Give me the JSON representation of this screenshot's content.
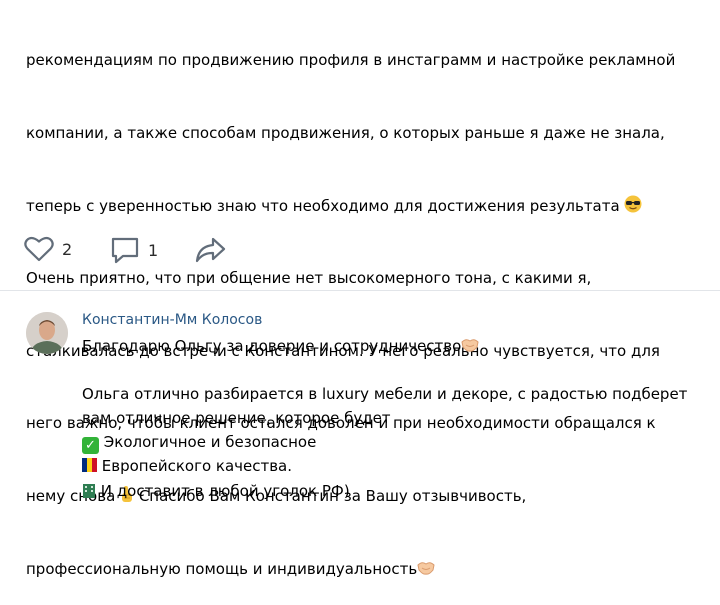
{
  "post": {
    "lines": [
      "рекомендациям по продвижению профиля в инстаграмм и настройке рекламной",
      "компании, а также способам продвижения, о которых раньше я даже не знала,",
      "теперь с уверенностью знаю что необходимо для достижения результата",
      "Очень приятно, что при общение нет высокомерного тона, с какими я,",
      "сталкивалась до встречи с Константином. У него реально чувствуется, что для",
      "него важно, чтобы клиент остался доволен и при необходимости обращался к",
      "нему снова",
      "Спасибо Вам Константин за Вашу отзывчивость,",
      "профессиональную помощь и индивидуальность"
    ]
  },
  "actions": {
    "likes": "2",
    "comments": "1"
  },
  "comment": {
    "author": "Константин-Мм Колосов",
    "lines": [
      "Благодарю Ольгу за доверие и сотрудничество",
      "",
      "Ольга отлично разбирается в luxury мебели и декоре, с радостью подберет",
      "вам отличное решение, которое будет",
      "Экологичное и безопасное",
      "Европейского качества.",
      "И доставит в любой уголок РФ)"
    ]
  },
  "icons": {
    "like": "heart-icon",
    "comment": "comment-icon",
    "share": "share-icon",
    "sunglasses": "sunglasses-emoji",
    "hand": "pointing-up-emoji",
    "handshake": "handshake-emoji",
    "check": "check-mark-emoji",
    "flag": "romania-flag-emoji",
    "building": "building-emoji"
  },
  "colors": {
    "author_link": "#2a5885",
    "icon_gray": "#626d7a",
    "divider": "#e2e5e9"
  }
}
